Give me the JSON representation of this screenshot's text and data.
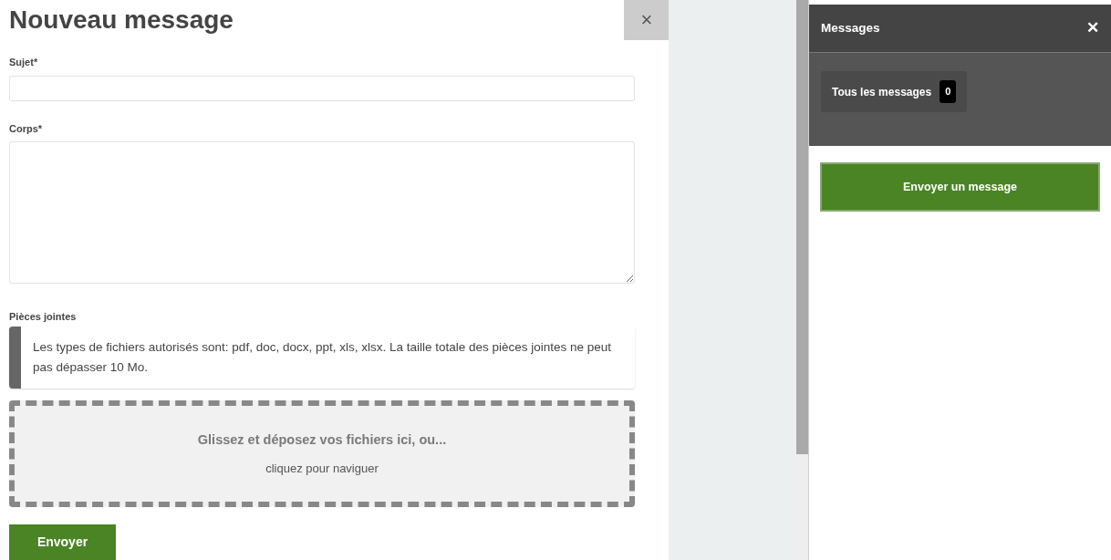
{
  "dialog": {
    "title": "Nouveau message",
    "close": "×",
    "fields": [
      {
        "kind": "input",
        "label": "Sujet*"
      },
      {
        "kind": "textarea",
        "label": "Corps*"
      }
    ],
    "attachments": {
      "label": "Pièces jointes",
      "note": "Les types de fichiers autorisés sont: pdf, doc, docx, ppt, xls, xlsx. La taille totale des pièces jointes ne peut pas dépasser 10 Mo.",
      "drop_title": "Glissez et déposez vos fichiers ici, ou...",
      "drop_hint": "cliquez pour naviguer"
    },
    "submit": "Envoyer"
  },
  "panel": {
    "title": "Messages",
    "close": "✕",
    "filters": [
      {
        "label": "Tous les messages",
        "count": "0"
      }
    ],
    "action": "Envoyer un message"
  }
}
